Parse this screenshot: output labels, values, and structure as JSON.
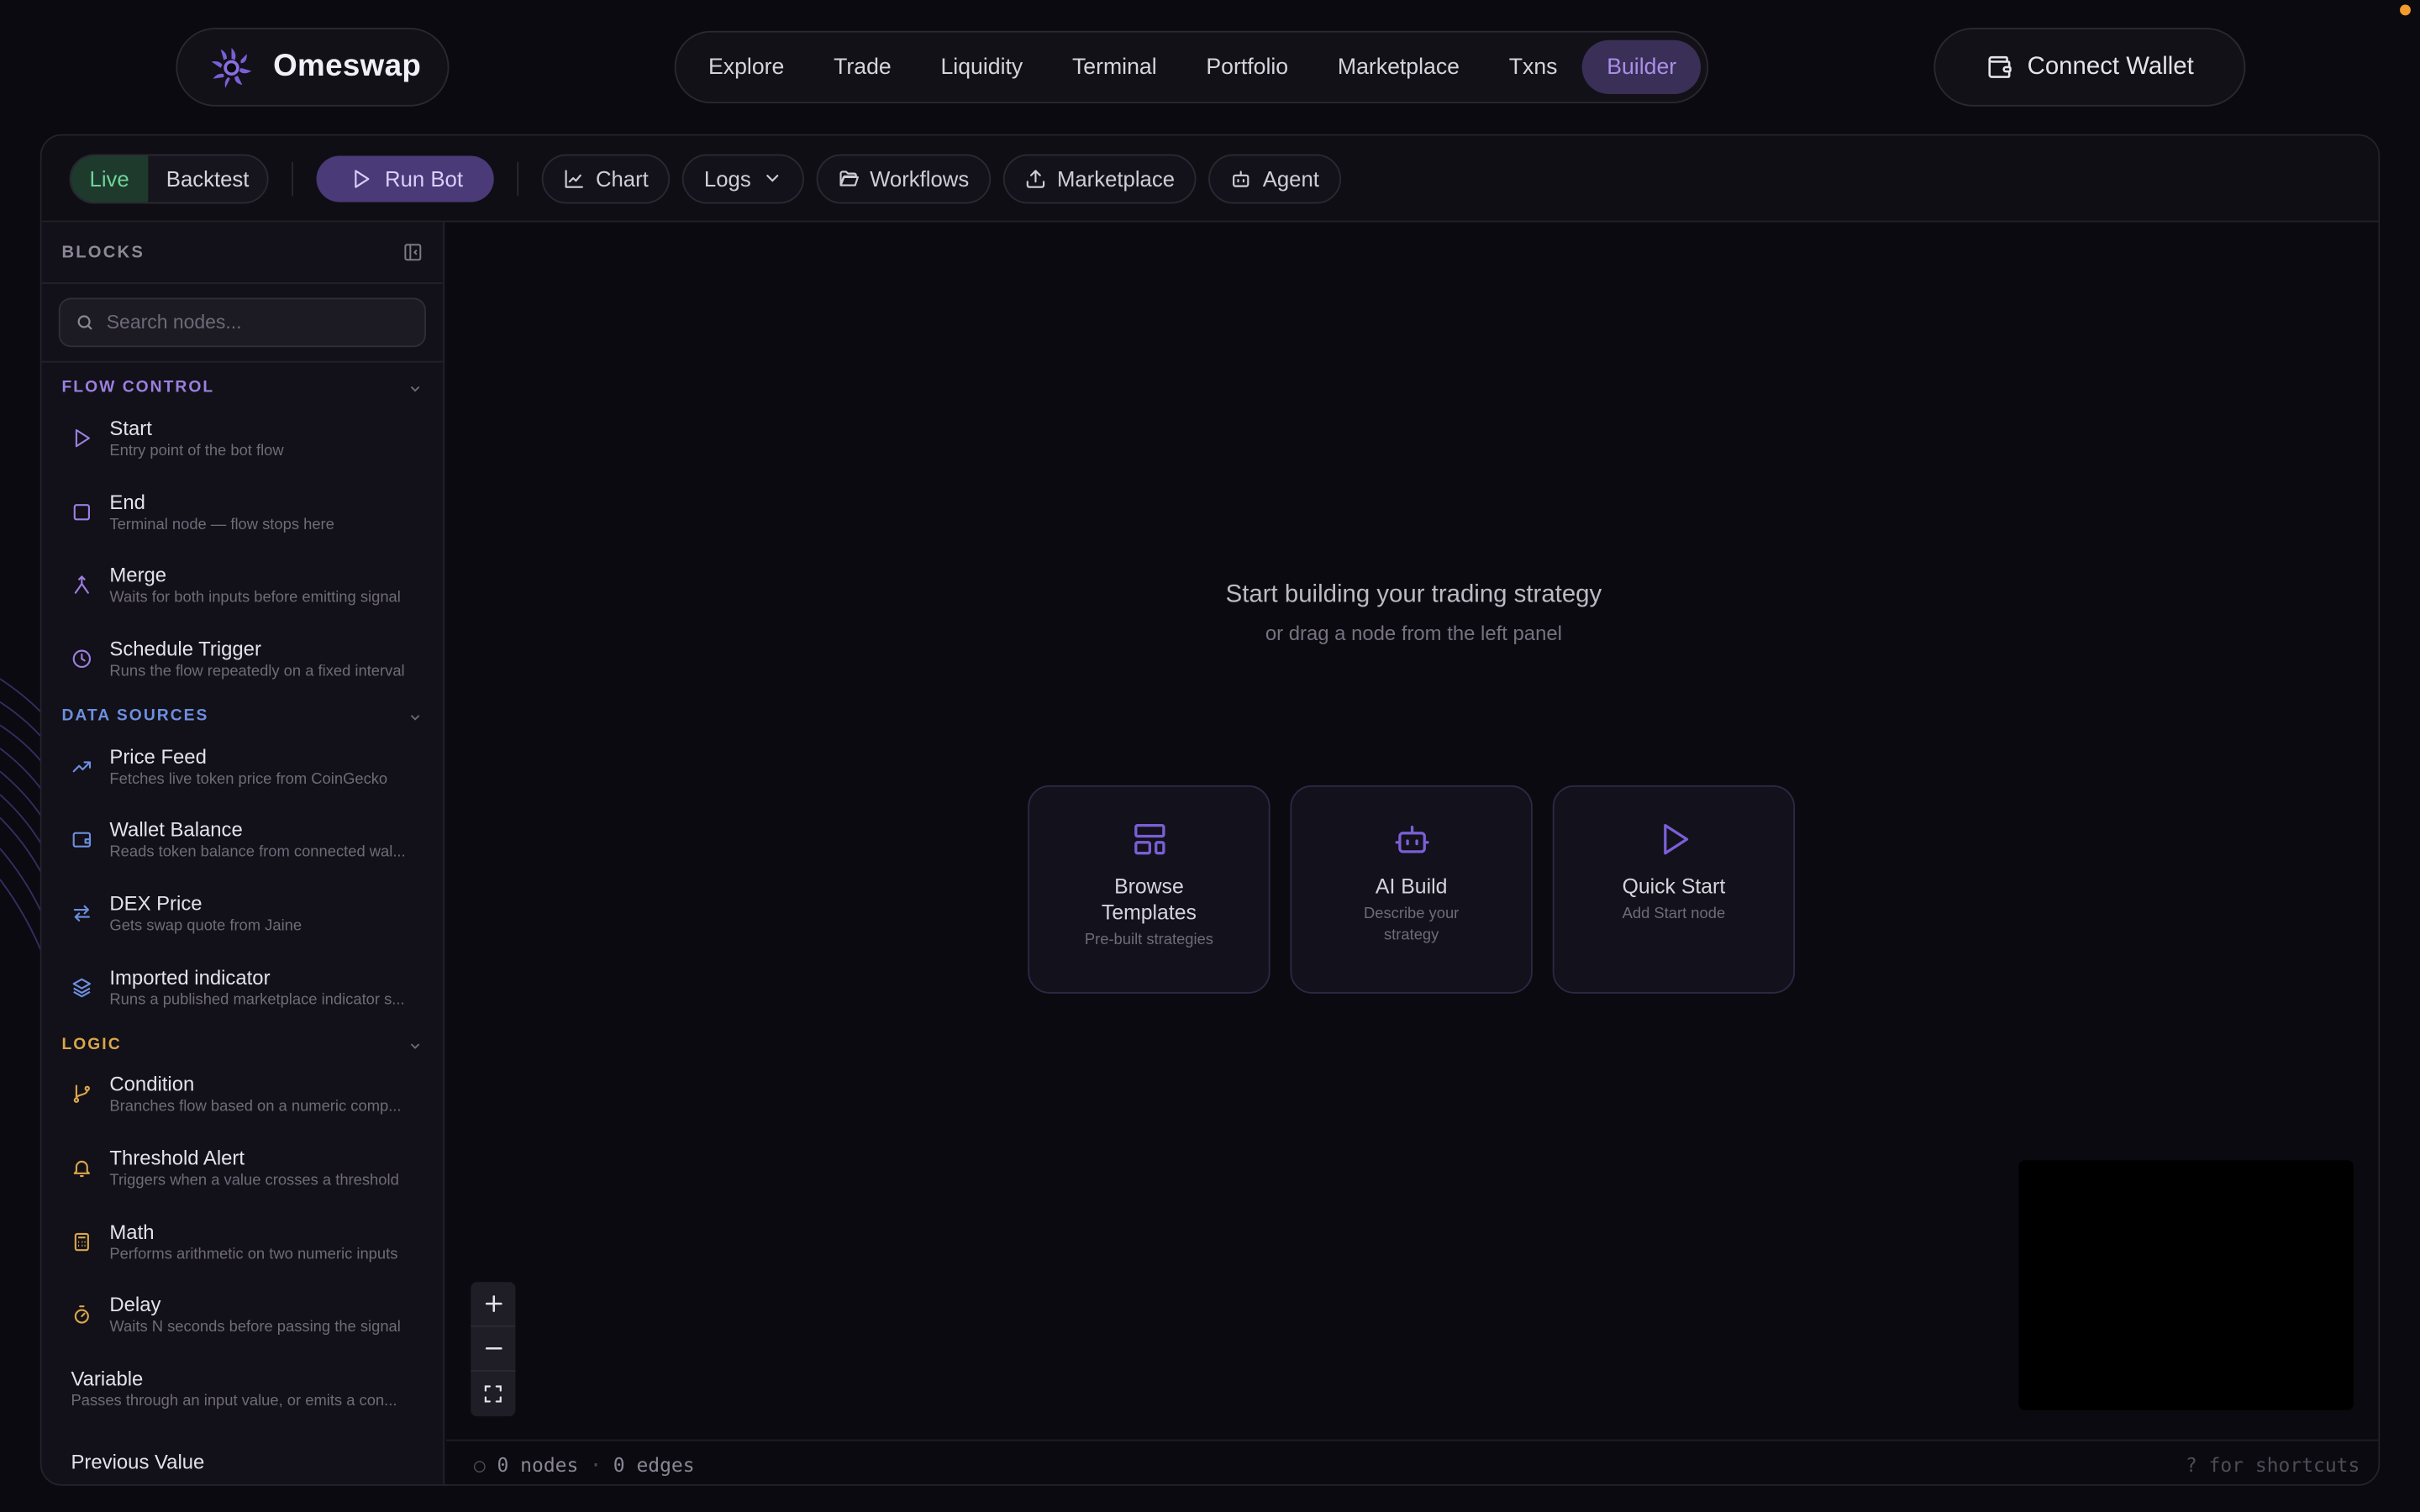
{
  "brand": {
    "name": "Omeswap"
  },
  "nav": {
    "items": [
      {
        "label": "Explore"
      },
      {
        "label": "Trade"
      },
      {
        "label": "Liquidity"
      },
      {
        "label": "Terminal"
      },
      {
        "label": "Portfolio"
      },
      {
        "label": "Marketplace"
      },
      {
        "label": "Txns"
      },
      {
        "label": "Builder",
        "active": true
      }
    ]
  },
  "wallet": {
    "label": "Connect Wallet",
    "icon": "wallet-icon"
  },
  "toolbar": {
    "mode": {
      "live": "Live",
      "backtest": "Backtest",
      "selected": "Live"
    },
    "run_label": "Run Bot",
    "chart_label": "Chart",
    "logs_label": "Logs",
    "workflows_label": "Workflows",
    "marketplace_label": "Marketplace",
    "agent_label": "Agent"
  },
  "sidebar": {
    "title": "BLOCKS",
    "search_placeholder": "Search nodes...",
    "sections": {
      "flow_control": {
        "label": "FLOW CONTROL",
        "color": "#9b7fe0",
        "items": [
          {
            "title": "Start",
            "desc": "Entry point of the bot flow",
            "icon": "play-icon"
          },
          {
            "title": "End",
            "desc": "Terminal node — flow stops here",
            "icon": "square-icon"
          },
          {
            "title": "Merge",
            "desc": "Waits for both inputs before emitting signal",
            "icon": "merge-icon"
          },
          {
            "title": "Schedule Trigger",
            "desc": "Runs the flow repeatedly on a fixed interval",
            "icon": "clock-icon"
          }
        ]
      },
      "data_sources": {
        "label": "DATA SOURCES",
        "color": "#6c8fe0",
        "items": [
          {
            "title": "Price Feed",
            "desc": "Fetches live token price from CoinGecko",
            "icon": "trending-up-icon"
          },
          {
            "title": "Wallet Balance",
            "desc": "Reads token balance from connected wal...",
            "icon": "wallet-icon"
          },
          {
            "title": "DEX Price",
            "desc": "Gets swap quote from Jaine",
            "icon": "swap-arrows-icon"
          },
          {
            "title": "Imported indicator",
            "desc": "Runs a published marketplace indicator s...",
            "icon": "layers-icon"
          }
        ]
      },
      "logic": {
        "label": "LOGIC",
        "color": "#d9a64a",
        "items": [
          {
            "title": "Condition",
            "desc": "Branches flow based on a numeric comp...",
            "icon": "git-branch-icon"
          },
          {
            "title": "Threshold Alert",
            "desc": "Triggers when a value crosses a threshold",
            "icon": "bell-icon"
          },
          {
            "title": "Math",
            "desc": "Performs arithmetic on two numeric inputs",
            "icon": "calculator-icon"
          },
          {
            "title": "Delay",
            "desc": "Waits N seconds before passing the signal",
            "icon": "timer-icon"
          },
          {
            "title": "Variable",
            "desc": "Passes through an input value, or emits a con..."
          },
          {
            "title": "Previous Value",
            "desc": ""
          }
        ]
      }
    }
  },
  "canvas": {
    "empty_title": "Start building your trading strategy",
    "empty_sub": "or drag a node from the left panel",
    "cards": [
      {
        "title": "Browse Templates",
        "desc": "Pre-built strategies",
        "icon": "layout-template-icon"
      },
      {
        "title": "AI Build",
        "desc": "Describe your strategy",
        "icon": "bot-icon"
      },
      {
        "title": "Quick Start",
        "desc": "Add Start node",
        "icon": "play-icon"
      }
    ],
    "status": {
      "nodes": "0 nodes",
      "separator": "·",
      "edges": "0 edges",
      "shortcut_hint": "? for shortcuts"
    }
  },
  "colors": {
    "accent": "#a98ee8",
    "run_bg": "#4a3a78",
    "live_green": "#6fd39a"
  }
}
